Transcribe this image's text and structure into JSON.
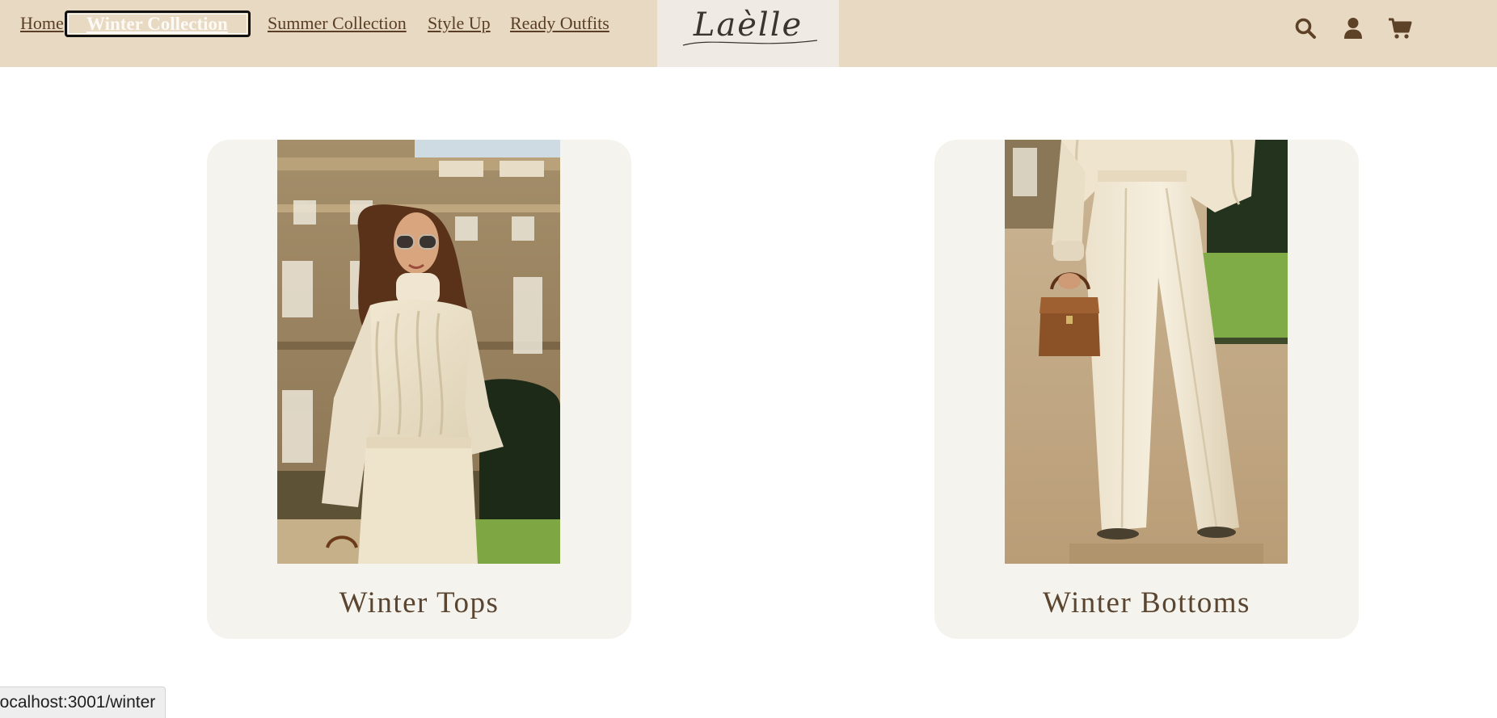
{
  "nav": {
    "home": "Home",
    "winter": "Winter Collection",
    "summer": "Summer Collection",
    "style_up": "Style Up",
    "ready_outfits": "Ready Outfits"
  },
  "brand": {
    "logo_text": "Laèlle"
  },
  "icons": [
    "search-icon",
    "user-icon",
    "cart-icon"
  ],
  "categories": [
    {
      "label": "Winter Tops"
    },
    {
      "label": "Winter Bottoms"
    }
  ],
  "status_url": "localhost:3001/winter",
  "colors": {
    "header_bg": "#e8d9c3",
    "logo_bg": "#efebe4",
    "nav_text": "#5a3f26",
    "card_bg": "#f5f3ee",
    "card_label": "#5a4530",
    "icon": "#5e4227"
  }
}
